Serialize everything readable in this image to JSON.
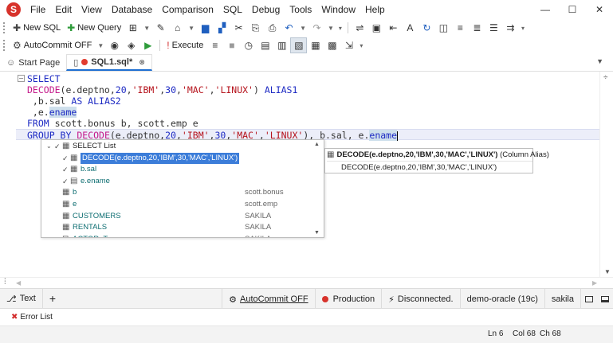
{
  "menubar": {
    "logo": "S",
    "items": [
      "File",
      "Edit",
      "View",
      "Database",
      "Comparison",
      "SQL",
      "Debug",
      "Tools",
      "Window",
      "Help"
    ],
    "minimize": "—",
    "maximize": "☐",
    "close": "✕"
  },
  "toolbar1": {
    "new_sql_label": "New SQL",
    "new_query_label": "New Query"
  },
  "toolbar2": {
    "autocommit_label": "AutoCommit OFF",
    "execute_label": "Execute"
  },
  "tabs": {
    "start_page": "Start Page",
    "sql_tab": "SQL1.sql*"
  },
  "editor": {
    "lines": [
      [
        {
          "t": "SELECT",
          "c": "kw"
        }
      ],
      [
        {
          "t": "DECODE",
          "c": "fn"
        },
        {
          "t": "(e.deptno,",
          "c": "pl"
        },
        {
          "t": "20",
          "c": "num"
        },
        {
          "t": ",",
          "c": "pl"
        },
        {
          "t": "'IBM'",
          "c": "str"
        },
        {
          "t": ",",
          "c": "pl"
        },
        {
          "t": "30",
          "c": "num"
        },
        {
          "t": ",",
          "c": "pl"
        },
        {
          "t": "'MAC'",
          "c": "str"
        },
        {
          "t": ",",
          "c": "pl"
        },
        {
          "t": "'LINUX'",
          "c": "str"
        },
        {
          "t": ") ",
          "c": "pl"
        },
        {
          "t": "ALIAS1",
          "c": "kw"
        }
      ],
      [
        {
          "t": " ,b.sal ",
          "c": "pl"
        },
        {
          "t": "AS",
          "c": "kw"
        },
        {
          "t": " ALIAS2",
          "c": "kw"
        }
      ],
      [
        {
          "t": " ,e.",
          "c": "pl"
        },
        {
          "t": "ename",
          "c": "kw hl"
        }
      ],
      [
        {
          "t": "FROM",
          "c": "kw"
        },
        {
          "t": " scott.bonus b, scott.emp e",
          "c": "pl"
        }
      ],
      [
        {
          "t": "GROUP BY",
          "c": "kw"
        },
        {
          "t": " ",
          "c": "pl"
        },
        {
          "t": "DECODE",
          "c": "fn"
        },
        {
          "t": "(e.deptno,",
          "c": "pl"
        },
        {
          "t": "20",
          "c": "num"
        },
        {
          "t": ",",
          "c": "pl"
        },
        {
          "t": "'IBM'",
          "c": "str"
        },
        {
          "t": ",",
          "c": "pl"
        },
        {
          "t": "30",
          "c": "num"
        },
        {
          "t": ",",
          "c": "pl"
        },
        {
          "t": "'MAC'",
          "c": "str"
        },
        {
          "t": ",",
          "c": "pl"
        },
        {
          "t": "'LINUX'",
          "c": "str"
        },
        {
          "t": "), b.sal, e.",
          "c": "pl"
        },
        {
          "t": "ename",
          "c": "kw hl"
        }
      ]
    ]
  },
  "completion": {
    "items": [
      {
        "label": "SELECT List",
        "source": "",
        "indent": 0,
        "expander": "⌄",
        "check": "✓",
        "icon": "▦",
        "selected": false,
        "teal": false
      },
      {
        "label": "DECODE(e.deptno,20,'IBM',30,'MAC','LINUX')",
        "source": "",
        "indent": 1,
        "expander": "",
        "check": "✓",
        "icon": "▦",
        "selected": true,
        "teal": false
      },
      {
        "label": "b.sal",
        "source": "",
        "indent": 1,
        "expander": "",
        "check": "✓",
        "icon": "▦",
        "selected": false,
        "teal": true
      },
      {
        "label": "e.ename",
        "source": "",
        "indent": 1,
        "expander": "",
        "check": "✓",
        "icon": "▤",
        "selected": false,
        "teal": true
      },
      {
        "label": "b",
        "source": "scott.bonus",
        "indent": 0,
        "expander": "",
        "check": "",
        "icon": "▦",
        "selected": false,
        "teal": true
      },
      {
        "label": "e",
        "source": "scott.emp",
        "indent": 0,
        "expander": "",
        "check": "",
        "icon": "▦",
        "selected": false,
        "teal": true
      },
      {
        "label": "CUSTOMERS",
        "source": "SAKILA",
        "indent": 0,
        "expander": "",
        "check": "",
        "icon": "▦",
        "selected": false,
        "teal": true
      },
      {
        "label": "RENTALS",
        "source": "SAKILA",
        "indent": 0,
        "expander": "",
        "check": "",
        "icon": "▦",
        "selected": false,
        "teal": true
      },
      {
        "label": "ACTOR_T",
        "source": "SAKILA",
        "indent": 0,
        "expander": "",
        "check": "",
        "icon": "⊡",
        "selected": false,
        "teal": true
      }
    ]
  },
  "tooltip": {
    "title": "DECODE(e.deptno,20,'IBM',30,'MAC','LINUX')",
    "suffix": " (Column Alias)",
    "body": "DECODE(e.deptno,20,'IBM',30,'MAC','LINUX')"
  },
  "statusbar": {
    "text_label": "Text",
    "add_label": "+",
    "autocommit_label": "AutoCommit OFF",
    "environment": "Production",
    "connection_status": "Disconnected.",
    "connection_name": "demo-oracle (19c)",
    "schema": "sakila"
  },
  "errorlist": {
    "label": "Error List"
  },
  "position": {
    "ln": "Ln 6",
    "col": "Col 68",
    "ch": "Ch 68"
  },
  "colors": {
    "accent": "#1f6fd1",
    "logo_red": "#d7322b",
    "keyword": "#1d2ac3",
    "function": "#c4198a",
    "string": "#b5121b",
    "selection": "#3c7dd9"
  }
}
